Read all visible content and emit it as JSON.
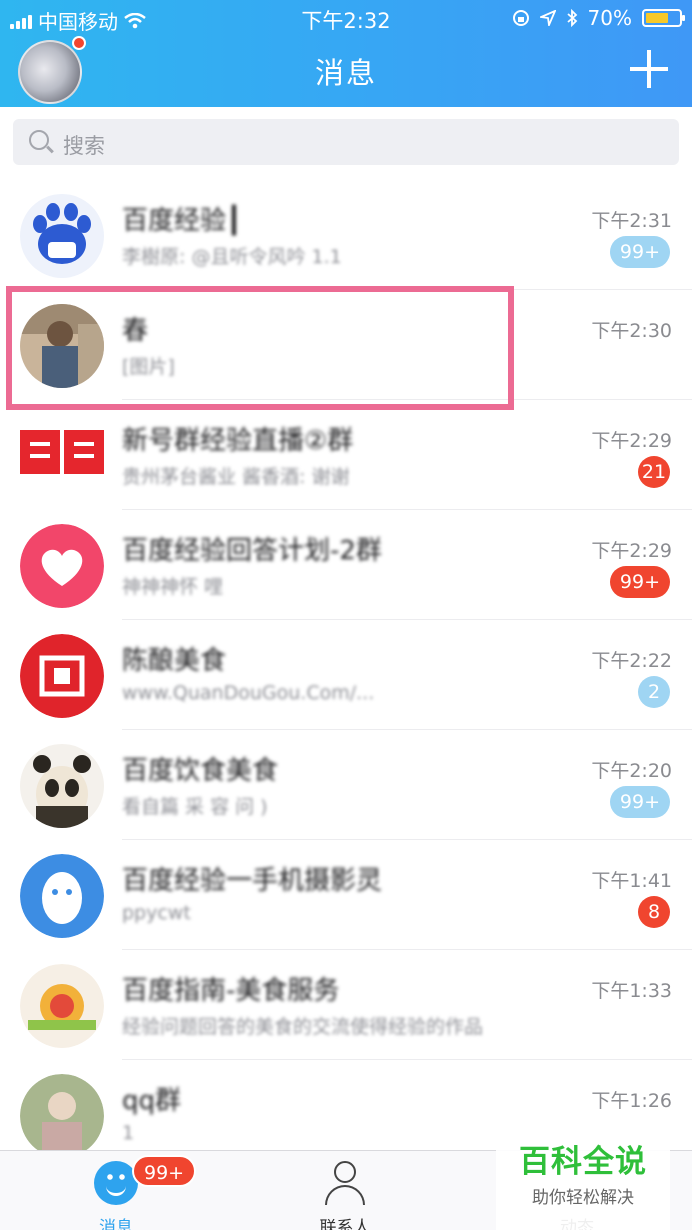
{
  "status_bar": {
    "carrier": "中国移动",
    "time": "下午2:32",
    "battery": "70%"
  },
  "header": {
    "title": "消息",
    "add_icon": "plus-icon"
  },
  "search": {
    "placeholder": "搜索"
  },
  "chats": [
    {
      "name": "百度经验┃",
      "message": "李樹原: @且听令风吟 1.1",
      "time": "下午2:31",
      "badge": "99+",
      "badge_color": "#9fd5f3"
    },
    {
      "name": "春",
      "message": "[图片]",
      "time": "下午2:30",
      "badge": ""
    },
    {
      "name": "新号群经验直播②群",
      "message": "贵州茅台酱业 酱香酒: 谢谢",
      "time": "下午2:29",
      "badge": "21",
      "badge_color": "#f0452f"
    },
    {
      "name": "百度经验回答计划-2群",
      "message": "神神神怀 哩",
      "time": "下午2:29",
      "badge": "99+",
      "badge_color": "#f0452f"
    },
    {
      "name": "陈酿美食",
      "message": "www.QuanDouGou.Com/...",
      "time": "下午2:22",
      "badge": "2",
      "badge_color": "#9fd5f3"
    },
    {
      "name": "百度饮食美食",
      "message": "看自篇 采 容 问 )",
      "time": "下午2:20",
      "badge": "99+",
      "badge_color": "#9fd5f3"
    },
    {
      "name": "百度经验一手机摄影灵",
      "message": "ppycwt",
      "time": "下午1:41",
      "badge": "8",
      "badge_color": "#f0452f"
    },
    {
      "name": "百度指南-美食服务",
      "message": "经验问题回答的美食的交流使得经验的作品",
      "time": "下午1:33",
      "badge": ""
    },
    {
      "name": "qq群",
      "message": "1",
      "time": "下午1:26",
      "badge": ""
    }
  ],
  "tabbar": {
    "messages": "消息",
    "messages_badge": "99+",
    "contacts": "联系人",
    "dongtai": "动态"
  },
  "watermark": {
    "title": "百科全说",
    "subtitle": "助你轻松解决"
  }
}
